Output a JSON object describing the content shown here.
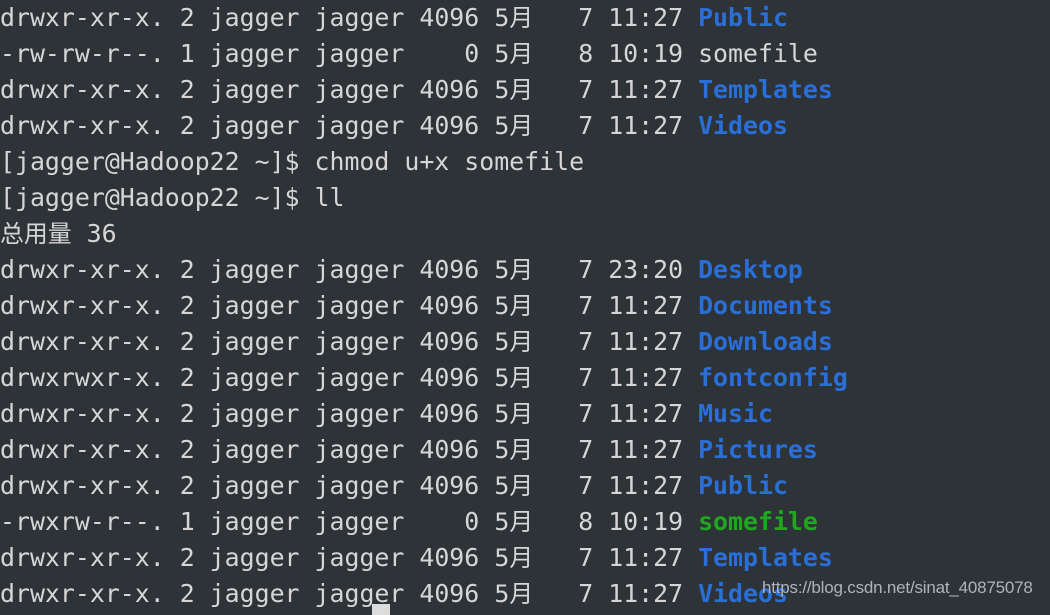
{
  "terminal": {
    "background_color": "#2e3338",
    "foreground_color": "#d6d6d6",
    "dir_color": "#2a6fd8",
    "exe_color": "#1ea81e",
    "file_color": "#d6d6d6",
    "prompt": "[jagger@Hadoop22 ~]$",
    "user": "jagger",
    "host": "Hadoop22",
    "cwd": "~",
    "month_label": "5月",
    "total_label": "总用量",
    "total_value": "36",
    "total_line": "总用量 36",
    "cursor": {
      "visible": true,
      "shape": "block"
    }
  },
  "lines": [
    {
      "type": "listing",
      "perms": "drwxr-xr-x.",
      "links": "2",
      "user": "jagger",
      "group": "jagger",
      "size": "4096",
      "month": "5月",
      "day": "7",
      "time": "11:27",
      "name": "Public",
      "kind": "dir"
    },
    {
      "type": "listing",
      "perms": "-rw-rw-r--.",
      "links": "1",
      "user": "jagger",
      "group": "jagger",
      "size": "0",
      "month": "5月",
      "day": "8",
      "time": "10:19",
      "name": "somefile",
      "kind": "file"
    },
    {
      "type": "listing",
      "perms": "drwxr-xr-x.",
      "links": "2",
      "user": "jagger",
      "group": "jagger",
      "size": "4096",
      "month": "5月",
      "day": "7",
      "time": "11:27",
      "name": "Templates",
      "kind": "dir"
    },
    {
      "type": "listing",
      "perms": "drwxr-xr-x.",
      "links": "2",
      "user": "jagger",
      "group": "jagger",
      "size": "4096",
      "month": "5月",
      "day": "7",
      "time": "11:27",
      "name": "Videos",
      "kind": "dir"
    },
    {
      "type": "command",
      "prompt": "[jagger@Hadoop22 ~]$",
      "command": "chmod u+x somefile"
    },
    {
      "type": "command",
      "prompt": "[jagger@Hadoop22 ~]$",
      "command": "ll"
    },
    {
      "type": "total",
      "text": "总用量 36"
    },
    {
      "type": "listing",
      "perms": "drwxr-xr-x.",
      "links": "2",
      "user": "jagger",
      "group": "jagger",
      "size": "4096",
      "month": "5月",
      "day": "7",
      "time": "23:20",
      "name": "Desktop",
      "kind": "dir"
    },
    {
      "type": "listing",
      "perms": "drwxr-xr-x.",
      "links": "2",
      "user": "jagger",
      "group": "jagger",
      "size": "4096",
      "month": "5月",
      "day": "7",
      "time": "11:27",
      "name": "Documents",
      "kind": "dir"
    },
    {
      "type": "listing",
      "perms": "drwxr-xr-x.",
      "links": "2",
      "user": "jagger",
      "group": "jagger",
      "size": "4096",
      "month": "5月",
      "day": "7",
      "time": "11:27",
      "name": "Downloads",
      "kind": "dir"
    },
    {
      "type": "listing",
      "perms": "drwxrwxr-x.",
      "links": "2",
      "user": "jagger",
      "group": "jagger",
      "size": "4096",
      "month": "5月",
      "day": "7",
      "time": "11:27",
      "name": "fontconfig",
      "kind": "dir"
    },
    {
      "type": "listing",
      "perms": "drwxr-xr-x.",
      "links": "2",
      "user": "jagger",
      "group": "jagger",
      "size": "4096",
      "month": "5月",
      "day": "7",
      "time": "11:27",
      "name": "Music",
      "kind": "dir"
    },
    {
      "type": "listing",
      "perms": "drwxr-xr-x.",
      "links": "2",
      "user": "jagger",
      "group": "jagger",
      "size": "4096",
      "month": "5月",
      "day": "7",
      "time": "11:27",
      "name": "Pictures",
      "kind": "dir"
    },
    {
      "type": "listing",
      "perms": "drwxr-xr-x.",
      "links": "2",
      "user": "jagger",
      "group": "jagger",
      "size": "4096",
      "month": "5月",
      "day": "7",
      "time": "11:27",
      "name": "Public",
      "kind": "dir"
    },
    {
      "type": "listing",
      "perms": "-rwxrw-r--.",
      "links": "1",
      "user": "jagger",
      "group": "jagger",
      "size": "0",
      "month": "5月",
      "day": "8",
      "time": "10:19",
      "name": "somefile",
      "kind": "exe"
    },
    {
      "type": "listing",
      "perms": "drwxr-xr-x.",
      "links": "2",
      "user": "jagger",
      "group": "jagger",
      "size": "4096",
      "month": "5月",
      "day": "7",
      "time": "11:27",
      "name": "Templates",
      "kind": "dir"
    },
    {
      "type": "listing",
      "perms": "drwxr-xr-x.",
      "links": "2",
      "user": "jagger",
      "group": "jagger",
      "size": "4096",
      "month": "5月",
      "day": "7",
      "time": "11:27",
      "name": "Videos",
      "kind": "dir"
    }
  ],
  "watermark": {
    "text": "https://blog.csdn.net/sinat_40875078"
  }
}
